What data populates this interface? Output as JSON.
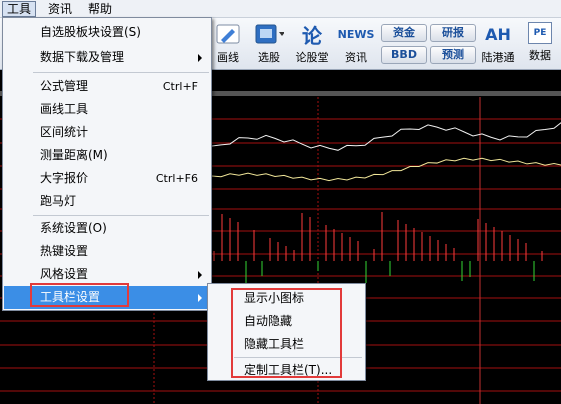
{
  "menubar": {
    "items": [
      {
        "label": "工具"
      },
      {
        "label": "资讯"
      },
      {
        "label": "帮助"
      }
    ]
  },
  "toolbar": {
    "buttons": [
      {
        "label": "画线",
        "icon": "pencil-icon"
      },
      {
        "label": "选股",
        "icon": "select-stock-icon"
      },
      {
        "label": "论股堂",
        "icon": "forum-icon",
        "icon_text": "论"
      },
      {
        "label": "资讯",
        "icon": "news-icon",
        "icon_text": "NEWS"
      },
      {
        "label": "陆港通",
        "icon": "ah-icon",
        "icon_text": "AH"
      },
      {
        "label": "数据",
        "icon": "pe-icon",
        "icon_text": "PE"
      }
    ],
    "pills": {
      "funds": "资金",
      "research": "研报",
      "bbd": "BBD",
      "forecast": "预测"
    }
  },
  "menu": {
    "items": [
      {
        "label": "自选股板块设置(S)",
        "shortcut": "",
        "submenu": false
      },
      {
        "label": "数据下载及管理",
        "shortcut": "",
        "submenu": true
      },
      {
        "label": "公式管理",
        "shortcut": "Ctrl+F",
        "submenu": false
      },
      {
        "label": "画线工具",
        "shortcut": "",
        "submenu": false
      },
      {
        "label": "区间统计",
        "shortcut": "",
        "submenu": false
      },
      {
        "label": "测量距离(M)",
        "shortcut": "",
        "submenu": false
      },
      {
        "label": "大字报价",
        "shortcut": "Ctrl+F6",
        "submenu": false
      },
      {
        "label": "跑马灯",
        "shortcut": "",
        "submenu": false
      },
      {
        "label": "系统设置(O)",
        "shortcut": "",
        "submenu": false
      },
      {
        "label": "热键设置",
        "shortcut": "",
        "submenu": false
      },
      {
        "label": "风格设置",
        "shortcut": "",
        "submenu": true
      },
      {
        "label": "工具栏设置",
        "shortcut": "",
        "submenu": true,
        "highlighted": true
      }
    ]
  },
  "submenu": {
    "items": [
      {
        "label": "显示小图标"
      },
      {
        "label": "自动隐藏"
      },
      {
        "label": "隐藏工具栏"
      },
      {
        "label": "定制工具栏(T)..."
      }
    ]
  },
  "colors": {
    "chart_bg": "#000000",
    "grid_red": "#a31010",
    "line_white": "#f2f2f2",
    "line_yellow": "#f2e79a",
    "bar_red": "#ff3b3b",
    "bar_green": "#33d633",
    "highlight": "#3b8ee6",
    "annotation": "#e23a3a"
  }
}
